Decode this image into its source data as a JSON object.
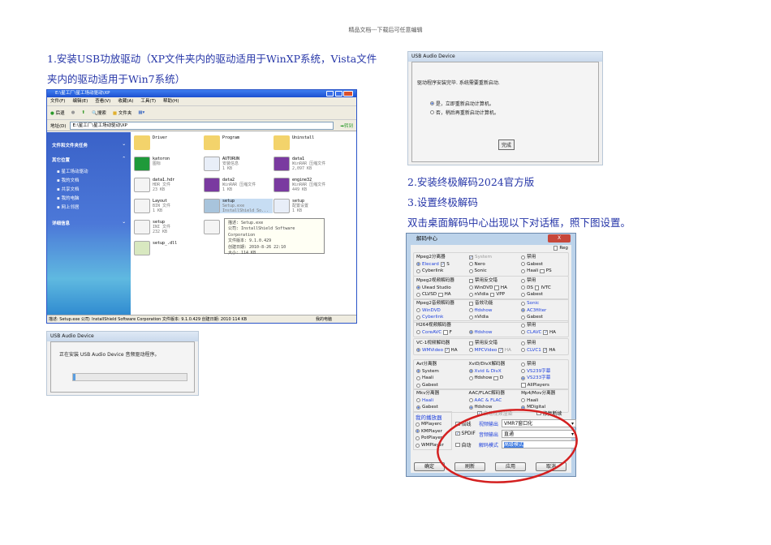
{
  "header": "精品文档---下载后可任意编辑",
  "step1": [
    "1.安装USB功放驱动（XP文件夹内的驱动适用于WinXP系统，Vista文件",
    "夹内的驱动适用于Win7系统）"
  ],
  "step2": "2.安装终极解码2024官方版",
  "step3": "3.设置终极解码",
  "step3_desc": "双击桌面解码中心出现以下对话框，照下图设置。",
  "explorer": {
    "title": "E:\\星工厂\\星工场动驱动\\XP",
    "menu": [
      "文件(F)",
      "编辑(E)",
      "查看(V)",
      "收藏(A)",
      "工具(T)",
      "帮助(H)"
    ],
    "toolbar": [
      "后退",
      "搜索",
      "文件夹"
    ],
    "address_label": "地址(D)",
    "address": "E:\\星工厂\\星工场动驱动\\XP",
    "go": "转到",
    "left": {
      "tasks": "文件和文件夹任务",
      "other": "其它位置",
      "places": [
        "星工场动驱动",
        "我的文档",
        "共享文档",
        "我的电脑",
        "网上邻居"
      ],
      "details": "详细信息"
    },
    "files": [
      {
        "name": "Driver",
        "type": "",
        "size": "",
        "icon": "folder"
      },
      {
        "name": "Program",
        "type": "",
        "size": "",
        "icon": "folder"
      },
      {
        "name": "Uninstall",
        "type": "",
        "size": "",
        "icon": "folder"
      },
      {
        "name": "katoron",
        "type": "图标",
        "size": "",
        "icon": "ico"
      },
      {
        "name": "AUTORUN",
        "type": "安装信息",
        "size": "1 KB",
        "icon": "inf"
      },
      {
        "name": "data1",
        "type": "WinRAR 压缩文件",
        "size": "2,097 KB",
        "icon": "rar"
      },
      {
        "name": "data1.hdr",
        "type": "HDR 文件",
        "size": "23 KB",
        "icon": "doc"
      },
      {
        "name": "data2",
        "type": "WinRAR 压缩文件",
        "size": "1 KB",
        "icon": "rar"
      },
      {
        "name": "engine32",
        "type": "WinRAR 压缩文件",
        "size": "449 KB",
        "icon": "rar"
      },
      {
        "name": "Layout",
        "type": "BIN 文件",
        "size": "1 KB",
        "icon": "doc"
      },
      {
        "name": "setup",
        "type": "Setup.exe",
        "size": "InstallShield So...",
        "icon": "exe",
        "selected": true
      },
      {
        "name": "setup",
        "type": "配置设置",
        "size": "1 KB",
        "icon": "inf"
      },
      {
        "name": "setup",
        "type": "INI 文件",
        "size": "232 KB",
        "icon": "doc"
      },
      {
        "name": "",
        "type": "",
        "size": "",
        "icon": "doc"
      },
      {
        "name": "",
        "type": "",
        "size": "",
        "icon": "none"
      },
      {
        "name": "setup_.dll",
        "type": "",
        "size": "",
        "icon": "dll"
      }
    ],
    "tooltip": [
      "描述: Setup.exe",
      "公司: InstallShield Software Corporation",
      "文件版本: 9.1.0.429",
      "创建日期: 2010-8-26 22:10",
      "大小: 114 KB"
    ],
    "status": "描述: Setup.exe 公司: InstallShield Software Corporation 文件版本: 9.1.0.429 创建日期: 2010 114 KB",
    "status_right": "我的电脑"
  },
  "install_dialog": {
    "title": "USB Audio Device",
    "message": "正在安装 USB Audio Device 音频驱动程序。",
    "progress": 0.02
  },
  "finish_dialog": {
    "title": "USB Audio Device",
    "message": "驱动程序安装完毕. 系统需要重新启动.",
    "options": [
      {
        "label": "是，立即重新启动计算机。",
        "checked": true
      },
      {
        "label": "否，稍后再重新启动计算机。",
        "checked": false
      }
    ],
    "button": "完成"
  },
  "decoder": {
    "title": "解码中心",
    "close": "X",
    "reg": "Reg",
    "sections": [
      [
        [
          {
            "t": "l",
            "x": "Mpeg2分离器"
          },
          {
            "t": "r",
            "on": true,
            "x": "Elecard",
            "b": true,
            "c": {
              "on": true,
              "x": "S"
            }
          },
          {
            "t": "r",
            "x": "Cyberlink"
          }
        ],
        [
          {
            "t": "c",
            "on": true,
            "x": "System",
            "g": true
          },
          {
            "t": "r",
            "x": "Nero"
          },
          {
            "t": "r",
            "x": "Sonic"
          }
        ],
        [
          {
            "t": "r",
            "x": "禁用"
          },
          {
            "t": "r",
            "x": "Gabest"
          },
          {
            "t": "r",
            "x": "Haali",
            "c": {
              "x": "PS"
            }
          }
        ]
      ],
      [
        [
          {
            "t": "l",
            "x": "Mpeg2视频解码器"
          },
          {
            "t": "r",
            "on": true,
            "x": "Ulead Studio"
          },
          {
            "t": "r",
            "x": "CLVSD",
            "c": {
              "x": "HA"
            }
          }
        ],
        [
          {
            "t": "c",
            "x": "禁用反交错"
          },
          {
            "t": "r",
            "x": "WinDVD",
            "c": {
              "x": "HA"
            }
          },
          {
            "t": "r",
            "x": "nVidia",
            "c": {
              "x": "VPP"
            }
          }
        ],
        [
          {
            "t": "r",
            "x": "禁用"
          },
          {
            "t": "r",
            "x": "DS",
            "c": {
              "x": "IVTC"
            }
          },
          {
            "t": "r",
            "x": "Gabest"
          }
        ]
      ],
      [
        [
          {
            "t": "l",
            "x": "Mpeg2音频解码器"
          },
          {
            "t": "r",
            "x": "WinDVD",
            "b": true
          },
          {
            "t": "r",
            "x": "Cyberlink",
            "b": true
          }
        ],
        [
          {
            "t": "c",
            "x": "音效功能"
          },
          {
            "t": "r",
            "x": "ffdshow",
            "b": true
          },
          {
            "t": "r",
            "x": "nVidia"
          }
        ],
        [
          {
            "t": "r",
            "x": "Sonic",
            "b": true
          },
          {
            "t": "r",
            "on": true,
            "x": "AC3filter",
            "b": true
          },
          {
            "t": "r",
            "x": "Gabest"
          }
        ]
      ],
      [
        [
          {
            "t": "l",
            "x": "H264视频解码器"
          },
          {
            "t": "r",
            "x": "CoreAVC",
            "b": true,
            "c": {
              "x": "F"
            }
          }
        ],
        [
          {
            "t": "l",
            "x": ""
          },
          {
            "t": "r",
            "on": true,
            "x": "ffdshow",
            "b": true
          }
        ],
        [
          {
            "t": "r",
            "x": "禁用"
          },
          {
            "t": "r",
            "x": "CLAVC",
            "b": true,
            "c": {
              "on": true,
              "x": "HA"
            }
          }
        ]
      ],
      [
        [
          {
            "t": "l",
            "x": "VC-1视频解码器"
          },
          {
            "t": "r",
            "on": true,
            "x": "WMVideo",
            "b": true,
            "c": {
              "on": true,
              "x": "HA"
            }
          }
        ],
        [
          {
            "t": "c",
            "x": "禁用反交错"
          },
          {
            "t": "r",
            "x": "MPCVideo",
            "b": true,
            "c": {
              "on": true,
              "x": "HA",
              "g": true
            }
          }
        ],
        [
          {
            "t": "r",
            "x": "禁用"
          },
          {
            "t": "r",
            "x": "CLVC1",
            "b": true,
            "c": {
              "on": true,
              "x": "HA"
            }
          }
        ]
      ],
      [
        [
          {
            "t": "l",
            "x": "Avi分离器"
          },
          {
            "t": "r",
            "on": true,
            "x": "System"
          },
          {
            "t": "r",
            "x": "Haali"
          },
          {
            "t": "r",
            "x": "Gabest"
          }
        ],
        [
          {
            "t": "l",
            "x": "XviD/DivX解码器"
          },
          {
            "t": "r",
            "on": true,
            "x": "Xvid & DivX",
            "b": true
          },
          {
            "t": "r",
            "x": "ffdshow",
            "c": {
              "x": "D"
            }
          }
        ],
        [
          {
            "t": "r",
            "x": "禁用"
          },
          {
            "t": "r",
            "x": "VS239字幕",
            "b": true
          },
          {
            "t": "r",
            "on": true,
            "x": "VS233字幕",
            "b": true
          },
          {
            "t": "c",
            "x": "AllPlayers"
          }
        ]
      ],
      [
        [
          {
            "t": "l",
            "x": "Mkv分离器"
          },
          {
            "t": "r",
            "x": "Haali",
            "b": true
          },
          {
            "t": "r",
            "on": true,
            "x": "Gabest"
          }
        ],
        [
          {
            "t": "l",
            "x": "AAC/FLAC解码器"
          },
          {
            "t": "r",
            "x": "AAC & FLAC",
            "b": true
          },
          {
            "t": "r",
            "on": true,
            "x": "ffdshow"
          }
        ],
        [
          {
            "t": "l",
            "x": "Mp4/Mov分离器"
          },
          {
            "t": "r",
            "x": "Haali"
          },
          {
            "t": "r",
            "on": true,
            "x": "MDigital"
          }
        ]
      ]
    ],
    "players_title": "我的播放器",
    "players": [
      {
        "x": "MPlayerc",
        "on": false
      },
      {
        "x": "KMPlayer",
        "on": true
      },
      {
        "x": "PotPlayer",
        "on": false
      },
      {
        "x": "WMPlayer",
        "on": false
      }
    ],
    "auto_render": "自动视频渲染",
    "fix": "修复断续",
    "opt_double": "倍线",
    "opt_spdif": "SPDIF",
    "opt_auto": "自动",
    "video_out_label": "视频输出",
    "video_out": "VMR7窗口化",
    "audio_out_label": "音频输出",
    "audio_out": "直通",
    "mode_label": "解码模式",
    "mode": "高级模式",
    "buttons": [
      "确定",
      "刷新",
      "应用",
      "取消"
    ],
    "highlight_color": "#d42020"
  }
}
